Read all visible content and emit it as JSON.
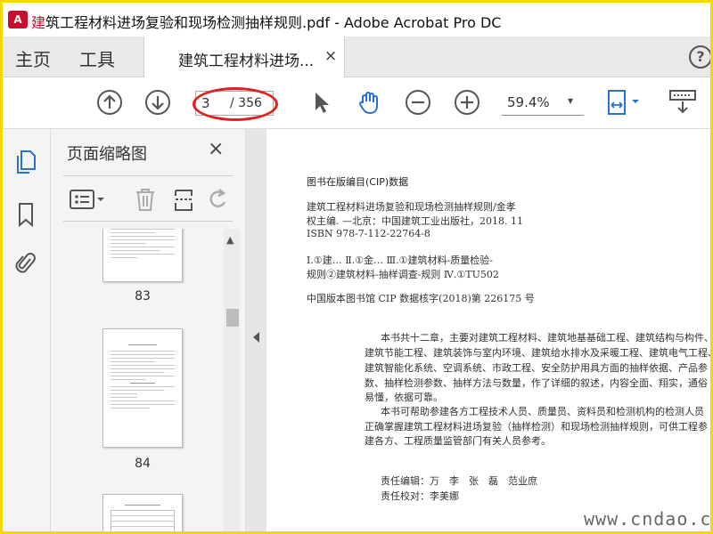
{
  "window": {
    "title_prefix": "建",
    "title_rest": "筑工程材料进场复验和现场检测抽样规则.pdf - Adobe Acrobat Pro DC",
    "app_icon_text": "A"
  },
  "menu": {
    "home": "主页",
    "tools": "工具"
  },
  "tab": {
    "label": "建筑工程材料进场...",
    "close": "×"
  },
  "help": "?",
  "toolbar": {
    "page_current": "3",
    "page_total": "/ 356",
    "zoom": "59.4%",
    "zoom_caret": "▾",
    "highlight_color": "#e0201e"
  },
  "panel": {
    "title": "页面缩略图",
    "close": "×",
    "thumbnails": [
      {
        "label": "83"
      },
      {
        "label": "84"
      }
    ]
  },
  "document": {
    "cip_heading": "图书在版编目(CIP)数据",
    "cip_lines": [
      "建筑工程材料进场复验和现场检测抽样规则/金孝",
      "权主编. —北京：中国建筑工业出版社，2018. 11",
      "ISBN 978-7-112-22764-8",
      "Ⅰ.①建…  Ⅱ.①金…  Ⅲ.①建筑材料-质量检验-",
      "规则②建筑材料-抽样调查-规则  Ⅳ.①TU502",
      "中国版本图书馆 CIP 数据核字(2018)第 226175 号"
    ],
    "body_lines": [
      "本书共十二章，主要对建筑工程材料、建筑地基基础工程、建筑结构与构件、",
      "建筑节能工程、建筑装饰与室内环境、建筑给水排水及采暖工程、建筑电气工程、",
      "建筑智能化系统、空调系统、市政工程、安全防护用具方面的抽样依据、产品参",
      "数、抽样检测参数、抽样方法与数量，作了详细的叙述，内容全面、翔实，通俗",
      "易懂，依据可靠。",
      "本书可帮助参建各方工程技术人员、质量员、资料员和检测机构的检测人员",
      "正确掌握建筑工程材料进场复验（抽样检测）和现场检测抽样规则，可供工程参",
      "建各方、工程质量监管部门有关人员参考。"
    ],
    "credits": [
      "责任编辑：万　李　张　磊　范业庶",
      "责任校对：李美娜"
    ],
    "watermark": "www.cndao.com"
  }
}
